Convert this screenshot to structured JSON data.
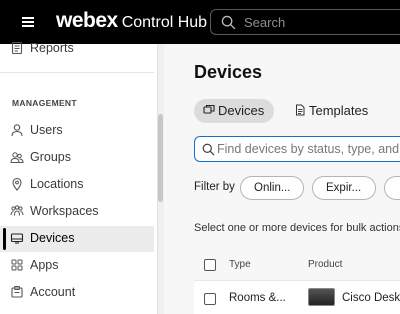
{
  "header": {
    "logo": "webex",
    "product": "Control Hub",
    "search_placeholder": "Search"
  },
  "sidebar": {
    "top_item": {
      "label": "Reports",
      "icon": "reports-icon"
    },
    "section_label": "MANAGEMENT",
    "items": [
      {
        "label": "Users",
        "icon": "user-icon",
        "active": false
      },
      {
        "label": "Groups",
        "icon": "groups-icon",
        "active": false
      },
      {
        "label": "Locations",
        "icon": "location-pin-icon",
        "active": false
      },
      {
        "label": "Workspaces",
        "icon": "workspaces-icon",
        "active": false
      },
      {
        "label": "Devices",
        "icon": "device-icon",
        "active": true
      },
      {
        "label": "Apps",
        "icon": "apps-icon",
        "active": false
      },
      {
        "label": "Account",
        "icon": "account-icon",
        "active": false
      }
    ]
  },
  "main": {
    "title": "Devices",
    "tabs": [
      {
        "label": "Devices",
        "icon": "devices-tab-icon",
        "active": true
      },
      {
        "label": "Templates",
        "icon": "document-icon",
        "active": false
      }
    ],
    "find_placeholder": "Find devices by status, type, and",
    "filter_label": "Filter by",
    "filter_chips": [
      "Onlin...",
      "Expir...",
      ""
    ],
    "bulk_text": "Select one or more devices for bulk actions",
    "table": {
      "columns": [
        "Type",
        "Product"
      ],
      "rows": [
        {
          "type": "Rooms &...",
          "product": "Cisco Desk"
        }
      ]
    }
  },
  "colors": {
    "header_bg": "#000000",
    "accent_blue": "#1170cf",
    "active_tab_bg": "#dcdcdc"
  }
}
